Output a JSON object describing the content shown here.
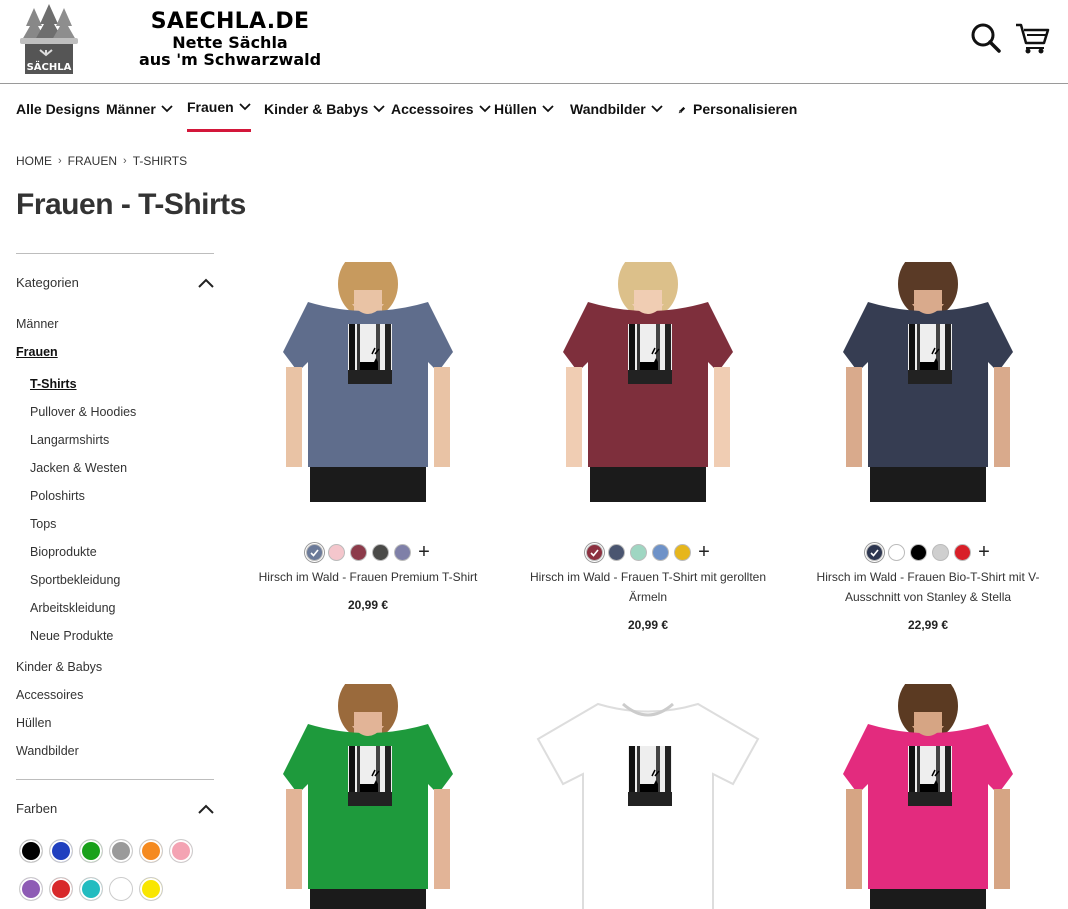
{
  "header": {
    "logo_text": "SÄCHLA",
    "brand_title": "SAECHLA.DE",
    "brand_line1": "Nette Sächla",
    "brand_line2": "aus 'm Schwarzwald"
  },
  "nav": {
    "items": [
      {
        "label": "Alle Designs",
        "dropdown": false
      },
      {
        "label": "Männer",
        "dropdown": true
      },
      {
        "label": "Frauen",
        "dropdown": true,
        "active": true
      },
      {
        "label": "Kinder & Babys",
        "dropdown": true
      },
      {
        "label": "Accessoires",
        "dropdown": true
      },
      {
        "label": "Hüllen",
        "dropdown": true
      },
      {
        "label": "Wandbilder",
        "dropdown": true
      },
      {
        "label": "Personalisieren",
        "icon": "pencil-icon"
      }
    ],
    "accent_color": "#d3173a"
  },
  "breadcrumb": [
    "HOME",
    "FRAUEN",
    "T-SHIRTS"
  ],
  "page_title": "Frauen - T-Shirts",
  "sidebar": {
    "categories_heading": "Kategorien",
    "categories": [
      {
        "label": "Männer",
        "level": 0
      },
      {
        "label": "Frauen",
        "level": 0,
        "selected": true
      },
      {
        "label": "T-Shirts",
        "level": 1,
        "selected": true
      },
      {
        "label": "Pullover & Hoodies",
        "level": 1
      },
      {
        "label": "Langarmshirts",
        "level": 1
      },
      {
        "label": "Jacken & Westen",
        "level": 1
      },
      {
        "label": "Poloshirts",
        "level": 1
      },
      {
        "label": "Tops",
        "level": 1
      },
      {
        "label": "Bioprodukte",
        "level": 1
      },
      {
        "label": "Sportbekleidung",
        "level": 1
      },
      {
        "label": "Arbeitskleidung",
        "level": 1
      },
      {
        "label": "Neue Produkte",
        "level": 1
      },
      {
        "label": "Kinder & Babys",
        "level": 0
      },
      {
        "label": "Accessoires",
        "level": 0
      },
      {
        "label": "Hüllen",
        "level": 0
      },
      {
        "label": "Wandbilder",
        "level": 0
      }
    ],
    "colors_heading": "Farben",
    "colors": [
      "#000000",
      "#1f3fbf",
      "#19a11a",
      "#9a9a9a",
      "#f58a1f",
      "#f4a3b3",
      "#8e5bb5",
      "#d8282a",
      "#22bcc0",
      "#ffffff",
      "#f9e600"
    ]
  },
  "products": [
    {
      "name": "Hirsch im Wald - Frauen Premium T-Shirt",
      "price": "20,99 €",
      "shirt_color": "#5f6d8c",
      "skin": "#e9c3a5",
      "hair": "#c79a5e",
      "swatches": [
        "#6b7a99",
        "#f4c6cc",
        "#8c3b4a",
        "#4a4a48",
        "#7f80a8"
      ],
      "selected_swatch": 0
    },
    {
      "name": "Hirsch im Wald - Frauen T-Shirt mit gerollten Ärmeln",
      "price": "20,99 €",
      "shirt_color": "#7e2f3c",
      "skin": "#f0cdb3",
      "hair": "#dcc08a",
      "swatches": [
        "#8c3040",
        "#4a5570",
        "#9fd6c2",
        "#6e92c8",
        "#e6b61c"
      ],
      "selected_swatch": 0
    },
    {
      "name": "Hirsch im Wald - Frauen Bio-T-Shirt mit V-Ausschnitt von Stanley & Stella",
      "price": "22,99 €",
      "shirt_color": "#363d52",
      "skin": "#d9aa8c",
      "hair": "#5a3a26",
      "swatches": [
        "#2d3650",
        "#ffffff",
        "#000000",
        "#cfcfcf",
        "#d81f28"
      ],
      "selected_swatch": 0
    },
    {
      "name": "",
      "price": "",
      "shirt_color": "#1e9a3c",
      "skin": "#e2b497",
      "hair": "#9a6a3c",
      "swatches": [],
      "selected_swatch": -1
    },
    {
      "name": "",
      "price": "",
      "shirt_color": "#ffffff",
      "skin": "",
      "hair": "",
      "swatches": [],
      "selected_swatch": -1
    },
    {
      "name": "",
      "price": "",
      "shirt_color": "#e32b7e",
      "skin": "#d6a584",
      "hair": "#5b3a22",
      "swatches": [],
      "selected_swatch": -1
    }
  ]
}
